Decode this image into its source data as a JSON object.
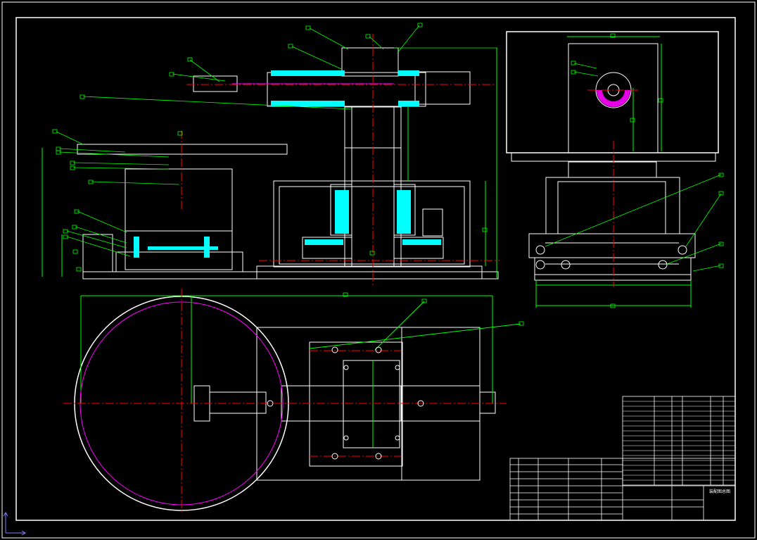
{
  "drawing": {
    "title_block_text": "装配图总图",
    "colors": {
      "background": "#000000",
      "outline": "#ffffff",
      "leader": "#00ff00",
      "centerline": "#ff0000",
      "section_fill": "#00ffff",
      "hidden": "#ff00ff"
    },
    "views": [
      "front-view",
      "side-view",
      "top-view"
    ],
    "icons": [
      "ucs-axis-icon"
    ]
  }
}
